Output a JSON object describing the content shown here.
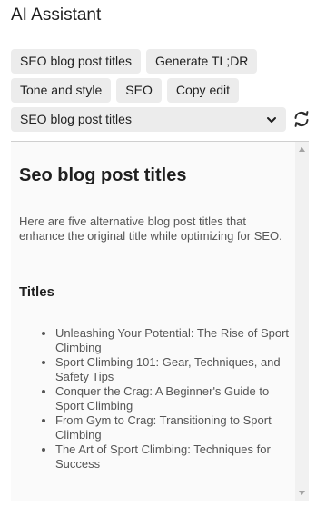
{
  "header": {
    "title": "AI Assistant"
  },
  "actions": {
    "row1": [
      {
        "label": "SEO blog post titles"
      },
      {
        "label": "Generate TL;DR"
      }
    ],
    "row2": [
      {
        "label": "Tone and style"
      },
      {
        "label": "SEO"
      },
      {
        "label": "Copy edit"
      }
    ]
  },
  "prompt_select": {
    "selected": "SEO blog post titles",
    "icon": "chevron-down-icon"
  },
  "refresh": {
    "icon": "refresh-icon"
  },
  "result": {
    "title": "Seo blog post titles",
    "intro": "Here are five alternative blog post titles that enhance the original title while optimizing for SEO.",
    "subheading": "Titles",
    "items": [
      "Unleashing Your Potential: The Rise of Sport Climbing",
      "Sport Climbing 101: Gear, Techniques, and Safety Tips",
      "Conquer the Crag: A Beginner's Guide to Sport Climbing",
      "From Gym to Crag: Transitioning to Sport Climbing",
      "The Art of Sport Climbing: Techniques for Success"
    ]
  },
  "colors": {
    "chip_bg": "#ececec",
    "text": "#1f1f1f",
    "muted_text": "#555555",
    "content_bg": "#fafafa"
  }
}
